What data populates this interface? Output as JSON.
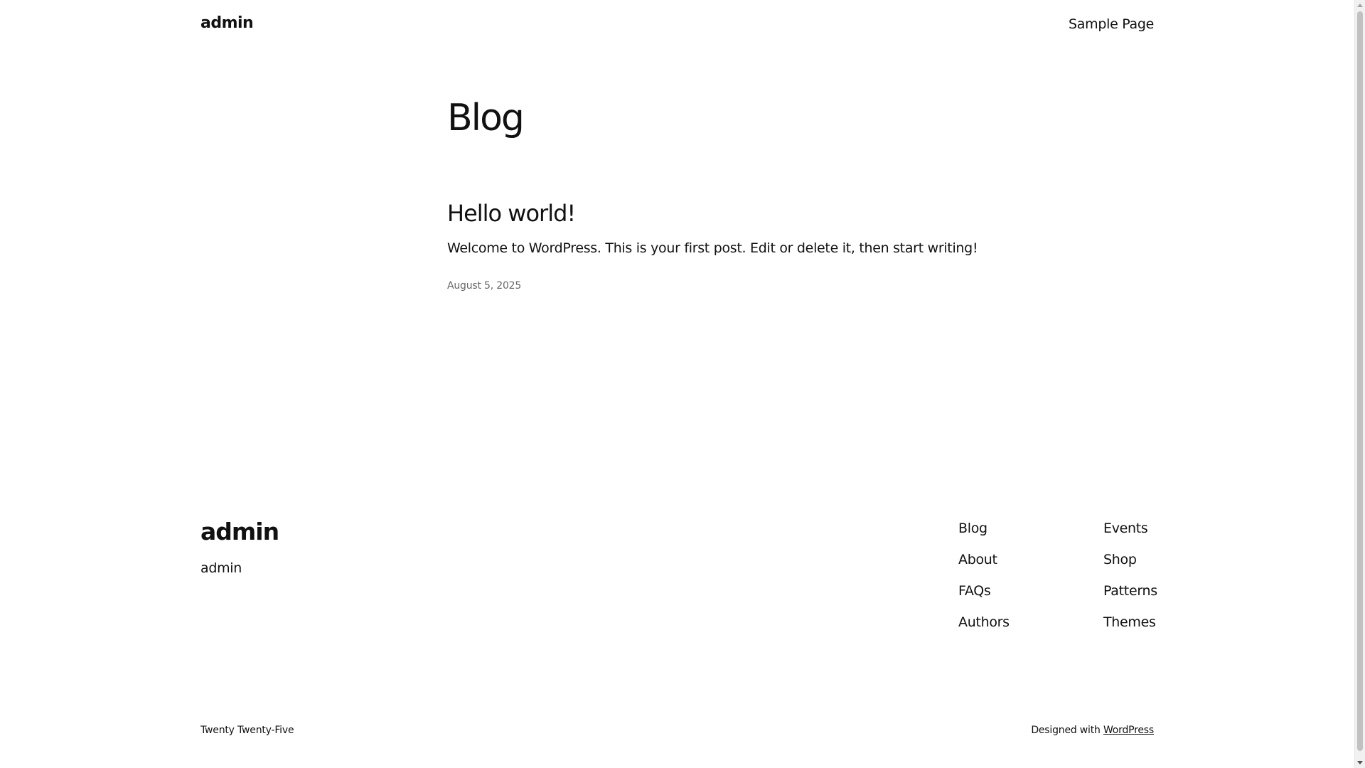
{
  "header": {
    "site_title": "admin",
    "nav_link": "Sample Page"
  },
  "main": {
    "page_heading": "Blog",
    "post": {
      "title": "Hello world!",
      "excerpt": "Welcome to WordPress. This is your first post. Edit or delete it, then start writing!",
      "date": "August 5, 2025"
    }
  },
  "footer": {
    "site_title": "admin",
    "tagline": "admin",
    "nav_col_1": [
      "Blog",
      "About",
      "FAQs",
      "Authors"
    ],
    "nav_col_2": [
      "Events",
      "Shop",
      "Patterns",
      "Themes"
    ],
    "theme_credit": "Twenty Twenty-Five",
    "designed_with_text": "Designed with",
    "designed_with_link": "WordPress"
  },
  "colors": {
    "text": "#111111",
    "muted": "#666666",
    "background": "#ffffff"
  }
}
